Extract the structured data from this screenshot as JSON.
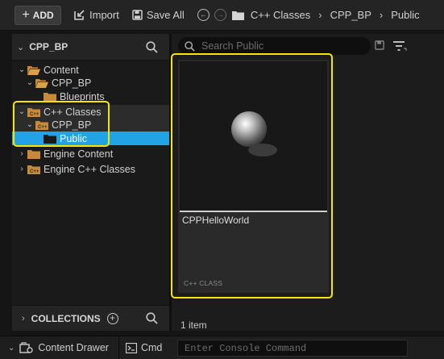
{
  "toolbar": {
    "add_label": "ADD",
    "import_label": "Import",
    "save_all_label": "Save All",
    "breadcrumbs": [
      "C++ Classes",
      "CPP_BP",
      "Public"
    ]
  },
  "sources_panel": {
    "title": "CPP_BP",
    "tree": [
      {
        "label": "Content",
        "depth": 0,
        "expanded": true,
        "type": "folder"
      },
      {
        "label": "CPP_BP",
        "depth": 1,
        "expanded": true,
        "type": "folder"
      },
      {
        "label": "Blueprints",
        "depth": 2,
        "expanded": false,
        "type": "folder"
      },
      {
        "label": "C++ Classes",
        "depth": 0,
        "expanded": true,
        "type": "cpp-folder"
      },
      {
        "label": "CPP_BP",
        "depth": 1,
        "expanded": true,
        "type": "cpp-folder"
      },
      {
        "label": "Public",
        "depth": 2,
        "expanded": false,
        "type": "folder-selected",
        "selected": true
      },
      {
        "label": "Engine Content",
        "depth": 0,
        "expanded": false,
        "type": "folder"
      },
      {
        "label": "Engine C++ Classes",
        "depth": 0,
        "expanded": false,
        "type": "cpp-folder"
      }
    ],
    "collections_label": "COLLECTIONS"
  },
  "content_panel": {
    "search_placeholder": "Search Public",
    "asset": {
      "name": "CPPHelloWorld",
      "kind": "C++ CLASS"
    },
    "item_count": "1 item"
  },
  "status_bar": {
    "content_drawer_label": "Content Drawer",
    "cmd_label": "Cmd",
    "console_placeholder": "Enter Console Command"
  },
  "colors": {
    "selection": "#21a3e6",
    "highlight": "#f5e600",
    "folder": "#c58a3c"
  }
}
